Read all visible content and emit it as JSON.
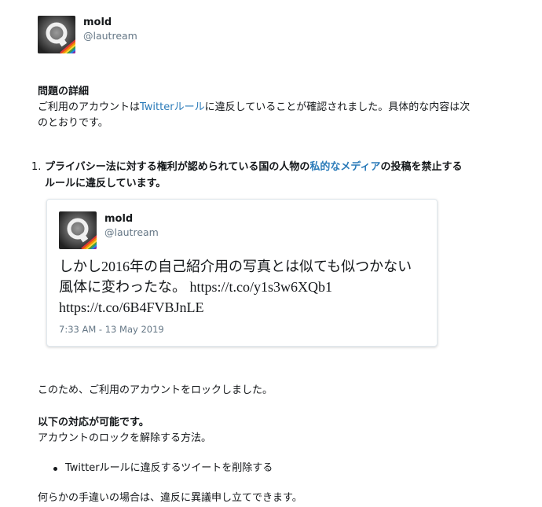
{
  "account": {
    "name": "mold",
    "handle": "@lautream"
  },
  "details": {
    "title": "問題の詳細",
    "intro_before_link": "ご利用のアカウントは",
    "intro_link": "Twitterルール",
    "intro_after_link_line1": "に違反していることが確認されました。具体的な内容は次",
    "intro_line2": "のとおりです。"
  },
  "violations": [
    {
      "number": "1.",
      "text_before_link": "プライバシー法に対する権利が認められている国の人物の",
      "link": "私的なメディア",
      "text_after_link_line1": "の投稿を禁止する",
      "text_line2": "ルールに違反しています。"
    }
  ],
  "tweet": {
    "name": "mold",
    "handle": "@lautream",
    "text_lines": [
      "しかし2016年の自己紹介用の写真とは似ても似つかない",
      "風体に変わったな。 https://t.co/y1s3w6XQb1",
      "https://t.co/6B4FVBJnLE"
    ],
    "timestamp": "7:33 AM - 13 May 2019"
  },
  "lock_notice": "このため、ご利用のアカウントをロックしました。",
  "options": {
    "title": "以下の対応が可能です。",
    "subtitle": "アカウントのロックを解除する方法。",
    "items": [
      "Twitterルールに違反するツイートを削除する"
    ]
  },
  "appeal_text": "何らかの手違いの場合は、違反に異議申し立てできます。",
  "colors": {
    "link": "#2b7bb9",
    "text": "#14171a",
    "muted": "#657786",
    "card_border": "#e1e8ed"
  },
  "icons": {
    "avatar": "avatar-image"
  }
}
